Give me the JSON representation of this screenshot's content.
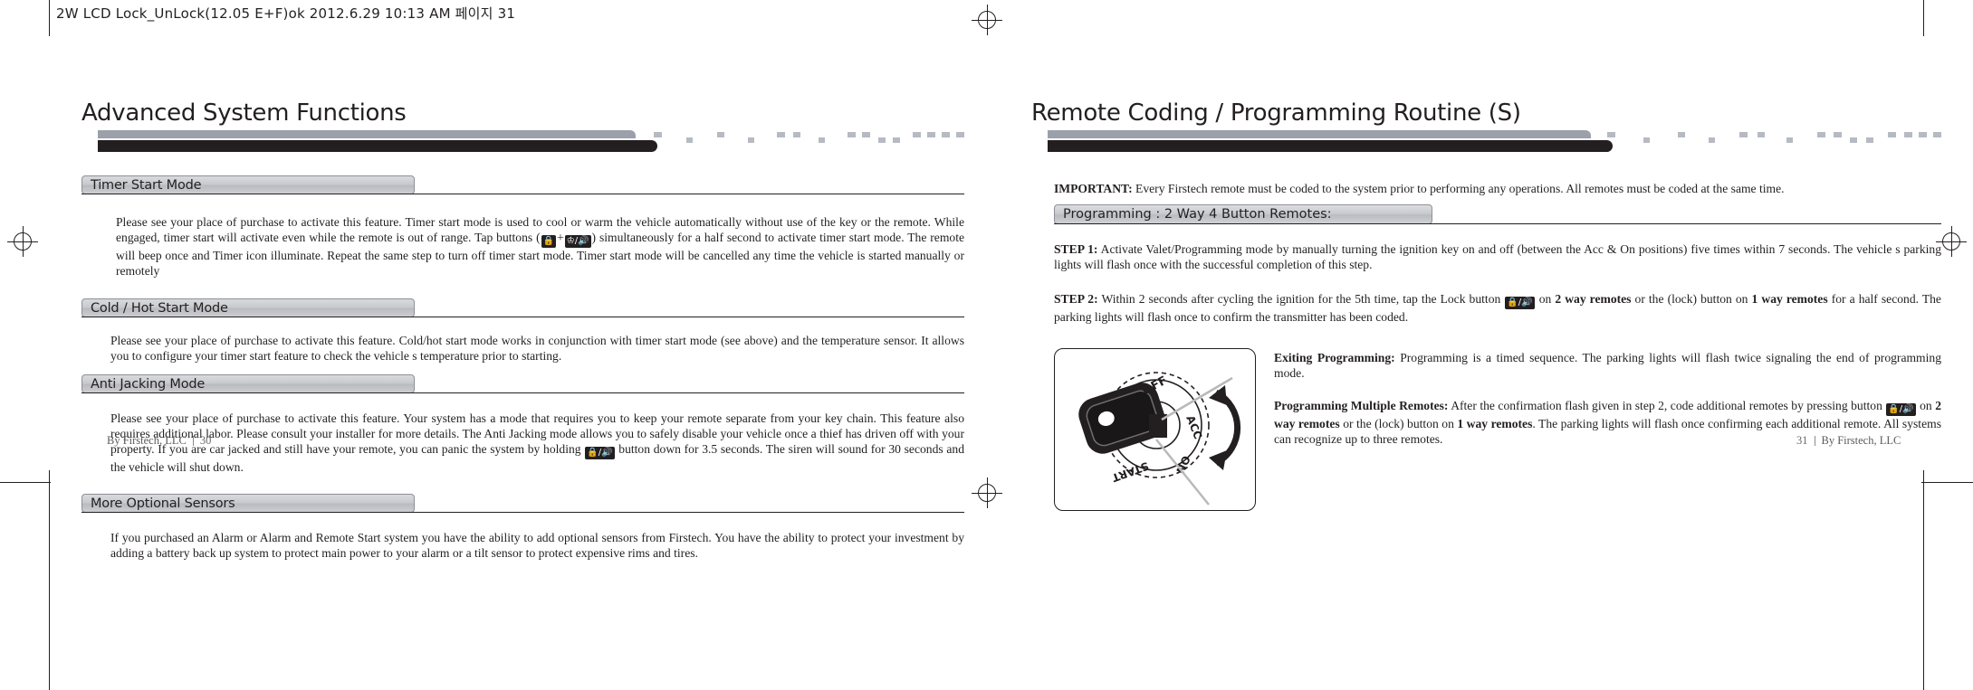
{
  "proof": {
    "header_text": "2W LCD Lock_UnLock(12.05 E+F)ok  2012.6.29 10:13 AM 페이지 31"
  },
  "left_page": {
    "title": "Advanced System Functions",
    "sections": [
      {
        "heading": "Timer Start Mode",
        "body_pre": "Please see your place of purchase to activate this feature. Timer start mode is used to cool or warm the vehicle automatically without use of the key or the remote. While engaged, timer start will activate even while the remote is out of range. Tap buttons (",
        "icon_a": "lock-icon",
        "icon_join": "+",
        "icon_b": "trunk-bell-icon",
        "body_post": ")  simultaneously for a half second to activate timer start mode. The remote will beep once and Timer icon illuminate. Repeat the same step to turn off timer start mode. Timer start mode will be cancelled any time the vehicle is started manually or remotely"
      },
      {
        "heading": "Cold / Hot Start Mode",
        "body_pre": "Please see your place of purchase to activate this feature. Cold/hot start mode works in conjunction with timer start mode (see above) and the temperature sensor. It allows you to configure your timer start feature to check the vehicle s temperature prior to starting.",
        "icon_a": "",
        "icon_join": "",
        "icon_b": "",
        "body_post": ""
      },
      {
        "heading": "Anti Jacking Mode",
        "body_pre": "Please see your place of purchase to activate this feature. Your system has a mode that requires you to keep your remote separate from your key chain. This feature also requires additional labor. Please consult your installer for more details. The Anti Jacking mode allows you to safely disable your vehicle once a thief has driven off with your property. If you are car jacked and still have your remote, you can panic the system by holding",
        "icon_a": "",
        "icon_join": "",
        "icon_b": "lock-bell-icon",
        "body_post": "button  down for 3.5 seconds. The siren will sound for 30 seconds and the vehicle will shut down."
      },
      {
        "heading": "More Optional Sensors",
        "body_pre": "If you purchased an Alarm or Alarm and Remote Start system you have the ability to add optional sensors from Firstech. You have the ability to protect your investment by adding a battery back up system to protect main power to your alarm or a tilt sensor to protect expensive rims and tires.",
        "icon_a": "",
        "icon_join": "",
        "icon_b": "",
        "body_post": ""
      }
    ],
    "footer": {
      "credit": "By Firstech, LLC",
      "page_number": "30"
    }
  },
  "right_page": {
    "title": "Remote Coding / Programming Routine (S)",
    "important_label": "IMPORTANT:",
    "important_text": "Every Firstech remote must be coded to the system prior to performing any operations. All remotes must be coded at the same time.",
    "programming_pill": "Programming : 2 Way 4 Button Remotes:",
    "steps": [
      {
        "label": "STEP 1:",
        "text": "Activate Valet/Programming mode by manually turning the ignition key on and off (between the Acc & On positions) five times within 7 seconds. The vehicle s parking lights will flash once with the successful completion of this step."
      }
    ],
    "step2": {
      "label": "STEP 2:",
      "t1": "Within 2 seconds after cycling the ignition for the 5th time, tap the Lock button",
      "icon": "lock-bell-icon",
      "t2": "on",
      "b1": "2 way remotes",
      "t3": "or the (lock) button on",
      "b2": "1 way remotes",
      "t4": "for a half second. The parking lights will flash once to confirm the transmitter has been coded."
    },
    "exiting": {
      "label": "Exiting Programming:",
      "text": "Programming is a timed sequence. The parking lights will flash twice signaling the end of programming mode."
    },
    "multiple": {
      "label": "Programming Multiple Remotes:",
      "t1": "After the confirmation flash given in step 2, code additional remotes by pressing button",
      "icon": "lock-bell-icon",
      "t2": "on",
      "b1": "2 way remotes",
      "t3": "or the (lock) button on",
      "b2": "1 way remotes",
      "t4": ". The parking lights will flash once confirming each additional remote. All systems can recognize up to three remotes."
    },
    "figure": {
      "name": "ignition-switch-diagram",
      "labels": [
        "OFF",
        "ACC",
        "ON",
        "START"
      ]
    },
    "footer": {
      "page_number": "31",
      "credit": "By Firstech, LLC"
    }
  },
  "colors": {
    "ink": "#231f20",
    "pill_grey": "#c8cace",
    "banner_grey": "#9ba0ab"
  }
}
